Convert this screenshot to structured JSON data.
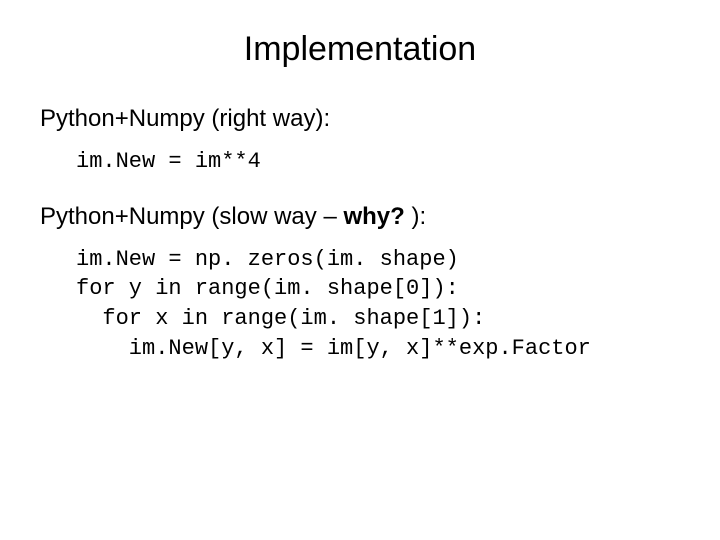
{
  "title": "Implementation",
  "section1": {
    "label": "Python+Numpy (right way):",
    "code": "im.New = im**4"
  },
  "section2": {
    "label_prefix": "Python+Numpy (slow way – ",
    "label_bold": "why?",
    "label_suffix": " ):",
    "code": "im.New = np. zeros(im. shape)\nfor y in range(im. shape[0]):\n  for x in range(im. shape[1]):\n    im.New[y, x] = im[y, x]**exp.Factor"
  }
}
